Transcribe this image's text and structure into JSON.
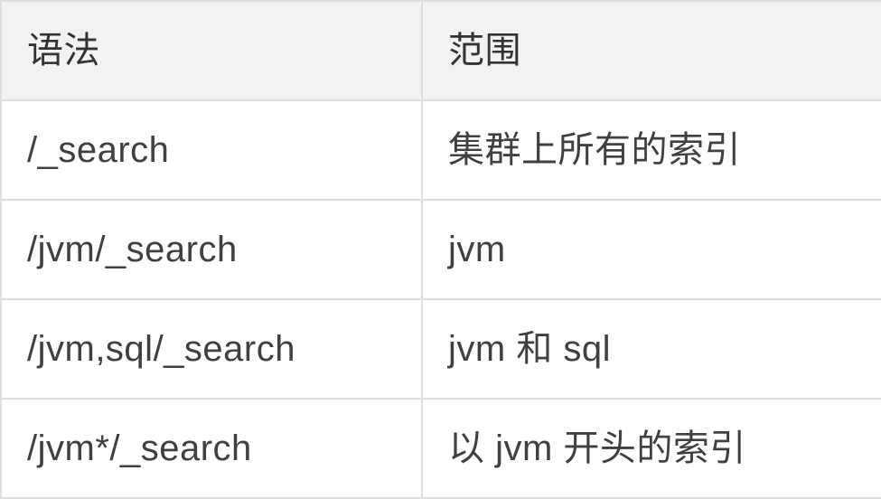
{
  "table": {
    "headers": [
      "语法",
      "范围"
    ],
    "rows": [
      {
        "syntax": "/_search",
        "scope": "集群上所有的索引"
      },
      {
        "syntax": "/jvm/_search",
        "scope": "jvm"
      },
      {
        "syntax": "/jvm,sql/_search",
        "scope": "jvm 和 sql"
      },
      {
        "syntax": "/jvm*/_search",
        "scope": "以 jvm 开头的索引"
      }
    ]
  }
}
